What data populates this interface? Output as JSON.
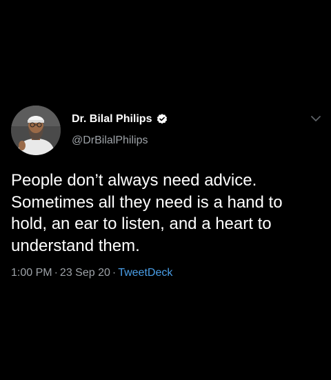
{
  "tweet": {
    "author": {
      "display_name": "Dr. Bilal Philips",
      "handle": "@DrBilalPhilips",
      "verified_icon": "verified-badge-icon",
      "avatar_alt": "avatar"
    },
    "body_lines": [
      "People don’t always need advice.",
      "Sometimes all they need is a hand to",
      "hold, an ear to listen, and a heart to",
      "understand them."
    ],
    "time": "1:00 PM",
    "date": "23 Sep 20",
    "source": "TweetDeck",
    "separator": "·",
    "more_icon": "chevron-down-icon"
  },
  "colors": {
    "background": "#000000",
    "text": "#ffffff",
    "secondary_text": "#9ea3a8",
    "link": "#4a9fe8"
  }
}
